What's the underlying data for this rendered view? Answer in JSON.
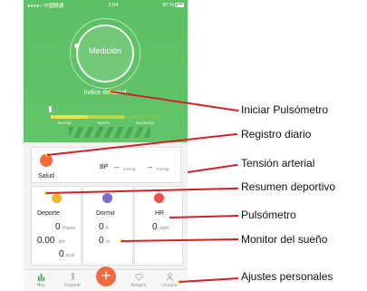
{
  "status_bar": {
    "carrier": "●●●●○ 中国联通",
    "time": "2:54",
    "battery": "87 %"
  },
  "header": {
    "measure_button": "Medición",
    "index_label": "índice de salud",
    "scale": [
      "Normal",
      "Bueno",
      "Excelente"
    ]
  },
  "salud_card": {
    "label": "Salud",
    "bp_label": "BP",
    "systolic": "--",
    "systolic_unit": "mmHg",
    "diastolic": "--",
    "diastolic_unit": "mmHg"
  },
  "sport_card": {
    "title": "Deporte",
    "steps": "0",
    "steps_unit": "Pasos",
    "distance": "0.00",
    "distance_unit": "km",
    "calories": "0",
    "calories_unit": "kcal"
  },
  "sleep_card": {
    "title": "Dormir",
    "hours": "0",
    "hours_unit": "h",
    "minutes": "0",
    "minutes_unit": "m"
  },
  "hr_card": {
    "title": "HR",
    "value": "0",
    "unit": "bpm"
  },
  "tabbar": {
    "tabs": [
      {
        "label": "Hoy"
      },
      {
        "label": "Deporte"
      },
      {
        "label": "Amigos"
      },
      {
        "label": "Usuario"
      }
    ],
    "plus": "+"
  },
  "annotations": [
    "Iniciar Pulsómetro",
    "Registro diario",
    "Tensión arterial",
    "Resumen deportivo",
    "Pulsómetro",
    "Monitor del sueño",
    "Ajustes personales"
  ],
  "colors": {
    "header_green": "#5dc065",
    "accent_orange": "#f26a3f",
    "annotation_red": "#d42027",
    "dot_yellow": "#f5d327"
  }
}
